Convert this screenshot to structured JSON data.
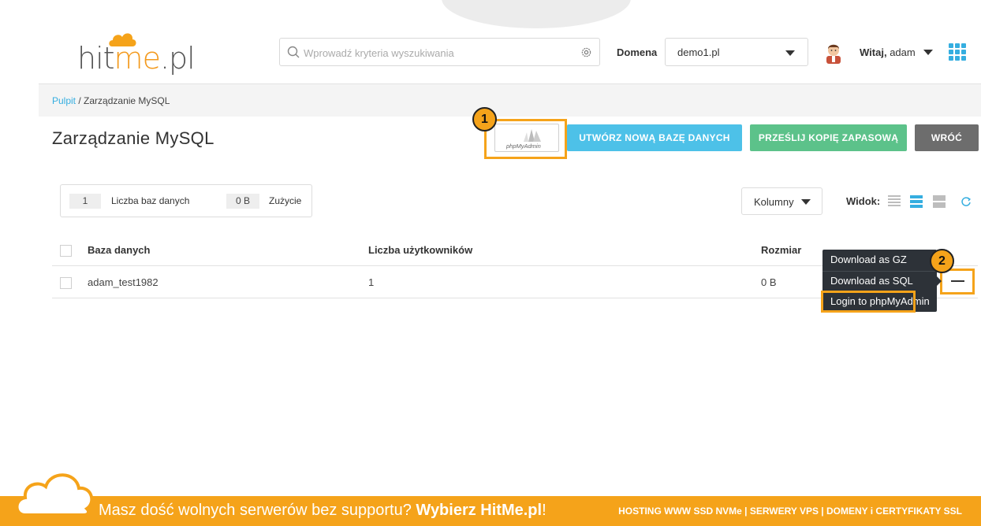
{
  "header": {
    "logo": {
      "part1": "hit",
      "part2": "me",
      "part3": ".pl"
    },
    "search": {
      "placeholder": "Wprowadź kryteria wyszukiwania"
    },
    "domain_label": "Domena",
    "domain_value": "demo1.pl",
    "greeting_bold": "Witaj,",
    "greeting_user": "adam"
  },
  "breadcrumb": {
    "home": "Pulpit",
    "separator": " / ",
    "current": "Zarządzanie MySQL"
  },
  "page": {
    "title": "Zarządzanie MySQL",
    "pma_logo_text": "phpMyAdmin",
    "buttons": {
      "create": "UTWÓRZ NOWĄ BAZĘ DANYCH",
      "backup": "PRZEŚLIJ KOPIĘ ZAPASOWĄ",
      "back": "WRÓĆ"
    },
    "badges": {
      "one": "1",
      "two": "2"
    }
  },
  "stats": {
    "db_count": "1",
    "db_count_label": "Liczba baz danych",
    "usage": "0 B",
    "usage_label": "Zużycie"
  },
  "toolbar": {
    "columns_label": "Kolumny",
    "view_label": "Widok:"
  },
  "table": {
    "headers": {
      "database": "Baza danych",
      "users": "Liczba użytkowników",
      "size": "Rozmiar"
    },
    "rows": [
      {
        "database": "adam_test1982",
        "users": "1",
        "size": "0 B"
      }
    ]
  },
  "dropdown": {
    "items": [
      "Download as GZ",
      "Download as SQL",
      "Login to phpMyAdmin"
    ]
  },
  "footer": {
    "message": "Masz dość wolnych serwerów bez supportu?",
    "message_bold": "Wybierz HitMe.pl",
    "message_end": "!",
    "links": "HOSTING WWW SSD NVMe | SERWERY VPS | DOMENY i CERTYFIKATY SSL"
  },
  "colors": {
    "accent_orange": "#f5a31a",
    "blue": "#4dc1e8",
    "green": "#5cc28a",
    "grey": "#6d6d6d"
  }
}
